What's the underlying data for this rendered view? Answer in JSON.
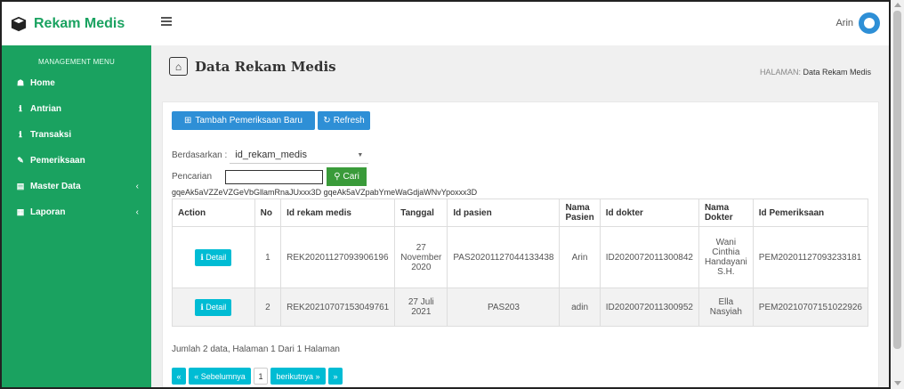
{
  "brand": {
    "name": "Rekam Medis",
    "icon": "cube-icon"
  },
  "user": {
    "name": "Arin"
  },
  "sidebar": {
    "header": "MANAGEMENT MENU",
    "items": [
      {
        "label": "Home",
        "icon": "home-icon"
      },
      {
        "label": "Antrian",
        "icon": "info-icon"
      },
      {
        "label": "Transaksi",
        "icon": "info-icon"
      },
      {
        "label": "Pemeriksaan",
        "icon": "edit-icon"
      },
      {
        "label": "Master Data",
        "icon": "database-icon",
        "chevron": "‹"
      },
      {
        "label": "Laporan",
        "icon": "calendar-icon",
        "chevron": "‹"
      }
    ]
  },
  "page": {
    "title": "Data Rekam Medis",
    "breadcrumb_label": "HALAMAN:",
    "breadcrumb_value": "Data Rekam Medis"
  },
  "toolbar": {
    "add_label": "Tambah Pemeriksaan Baru",
    "refresh_label": "Refresh"
  },
  "filter": {
    "by_label": "Berdasarkan :",
    "by_value": "id_rekam_medis",
    "search_label": "Pencarian",
    "search_value": "",
    "search_button": "Cari"
  },
  "token_text": "gqeAk5aVZZeVZGeVbGllamRnaJUxxx3D gqeAk5aVZpabYmeWaGdjaWNvYpoxxx3D",
  "table": {
    "headers": [
      "Action",
      "No",
      "Id rekam medis",
      "Tanggal",
      "Id pasien",
      "Nama Pasien",
      "Id dokter",
      "Nama Dokter",
      "Id Pemeriksaan"
    ],
    "rows": [
      {
        "action": "Detail",
        "no": "1",
        "id_rekam_medis": "REK20201127093906196",
        "tanggal": "27 November 2020",
        "id_pasien": "PAS20201127044133438",
        "nama_pasien": "Arin",
        "id_dokter": "ID2020072011300842",
        "nama_dokter": "Wani Cinthia Handayani S.H.",
        "id_pemeriksaan": "PEM20201127093233181"
      },
      {
        "action": "Detail",
        "no": "2",
        "id_rekam_medis": "REK20210707153049761",
        "tanggal": "27 Juli 2021",
        "id_pasien": "PAS203",
        "nama_pasien": "adin",
        "id_dokter": "ID2020072011300952",
        "nama_dokter": "Ella Nasyiah",
        "id_pemeriksaan": "PEM20210707151022926"
      }
    ]
  },
  "footer": {
    "summary": "Jumlah 2 data, Halaman 1 Dari 1 Halaman"
  },
  "pagination": {
    "first": "«",
    "prev": "« Sebelumnya",
    "current": "1",
    "next": "berikutnya »",
    "last": "»"
  },
  "colors": {
    "brand_green": "#1aa260",
    "primary_blue": "#2e8fd6",
    "info_cyan": "#00bcd4",
    "success_green": "#3a9b3a"
  }
}
